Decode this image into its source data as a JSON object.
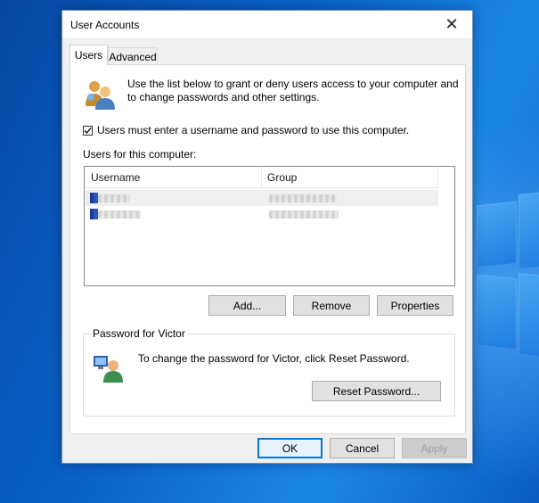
{
  "window": {
    "title": "User Accounts",
    "close_glyph": "✕"
  },
  "tabs": [
    {
      "label": "Users",
      "active": true
    },
    {
      "label": "Advanced",
      "active": false
    }
  ],
  "users_tab": {
    "intro_text": "Use the list below to grant or deny users access to your computer and to change passwords and other settings.",
    "intro_icon": "users-icon",
    "require_login_checkbox": {
      "label": "Users must enter a username and password to use this computer.",
      "checked": true
    },
    "users_list_label": "Users for this computer:",
    "users_table": {
      "columns": [
        "Username",
        "Group"
      ],
      "rows": [
        {
          "username": "",
          "group": "",
          "obscured": true,
          "selected": true
        },
        {
          "username": "",
          "group": "",
          "obscured": true,
          "selected": false
        }
      ]
    },
    "buttons": {
      "add": "Add...",
      "remove": "Remove",
      "properties": "Properties"
    },
    "password_group": {
      "legend": "Password for Victor",
      "icon": "user-password-icon",
      "text": "To change the password for Victor, click Reset Password.",
      "reset_button": "Reset Password..."
    }
  },
  "footer": {
    "ok": "OK",
    "cancel": "Cancel",
    "apply": "Apply",
    "apply_disabled": true
  },
  "colors": {
    "accent": "#0078d7",
    "desktop": "#0a62c9"
  }
}
